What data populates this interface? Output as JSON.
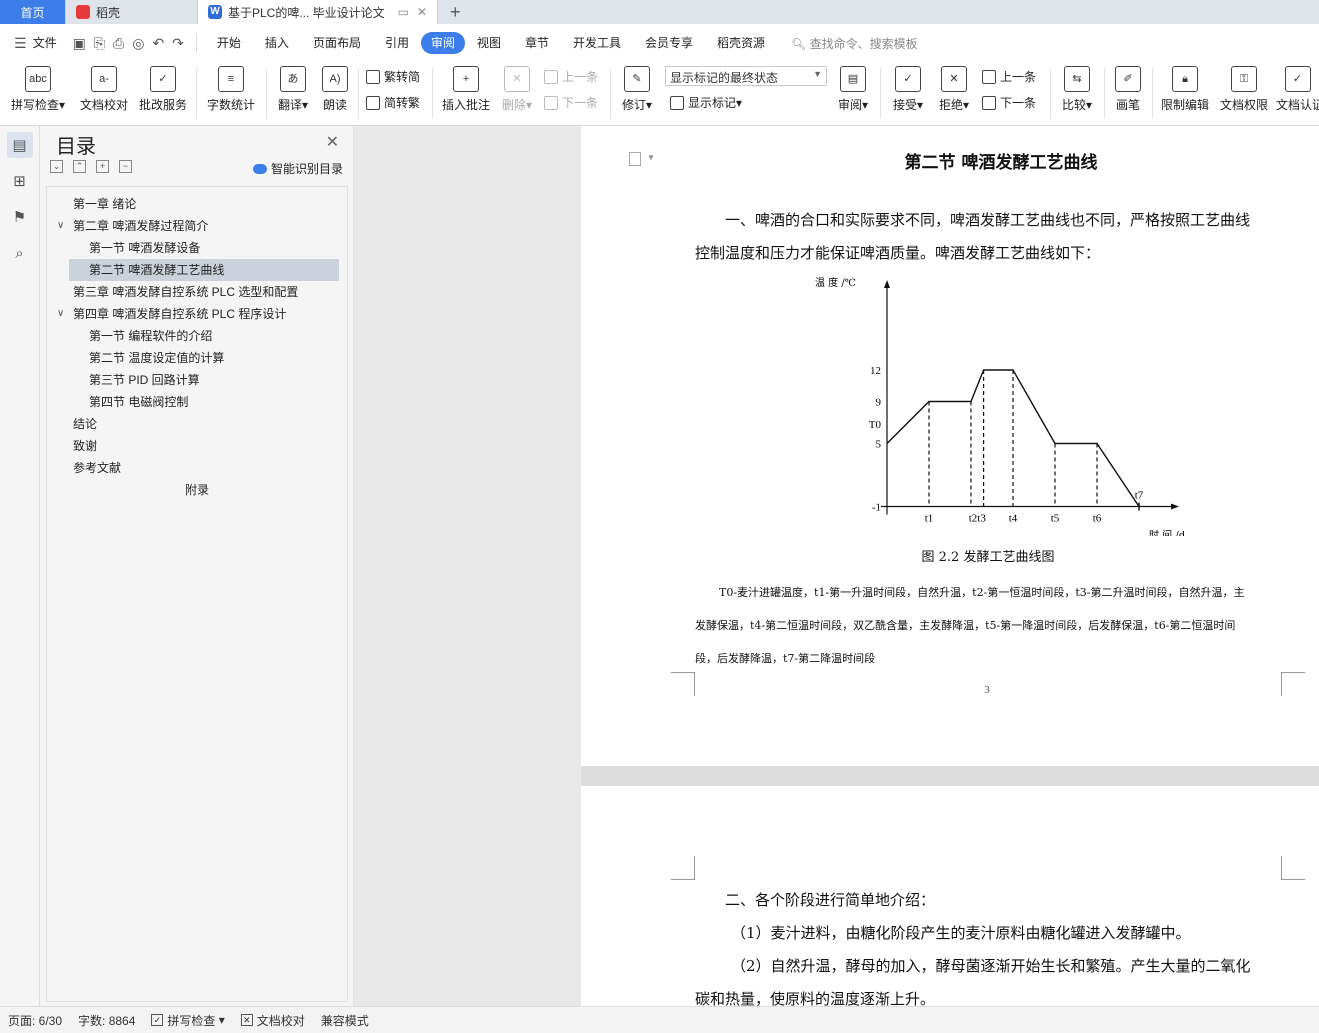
{
  "tabs": {
    "home": "首页",
    "daoke": "稻壳",
    "doc": "基于PLC的啤... 毕业设计论文",
    "new_tab": "+"
  },
  "menu": {
    "file": "文件",
    "items": [
      "开始",
      "插入",
      "页面布局",
      "引用",
      "审阅",
      "视图",
      "章节",
      "开发工具",
      "会员专享",
      "稻壳资源"
    ],
    "active": "审阅",
    "search_placeholder": "查找命令、搜索模板"
  },
  "ribbon": {
    "spell_check": "拼写检查",
    "doc_proof": "文档校对",
    "batch_service": "批改服务",
    "word_count": "字数统计",
    "translate": "翻译",
    "read_aloud": "朗读",
    "trad_to_simp": "繁转简",
    "simp_to_trad": "简转繁",
    "insert_comment": "插入批注",
    "delete": "删除",
    "prev_comment": "上一条",
    "next_comment": "下一条",
    "track": "修订",
    "markup_combo": "显示标记的最终状态",
    "show_markup": "显示标记",
    "review": "审阅",
    "accept": "接受",
    "reject": "拒绝",
    "prev_change": "上一条",
    "next_change": "下一条",
    "compare": "比较",
    "pen": "画笔",
    "restrict_edit": "限制编辑",
    "doc_rights": "文档权限",
    "doc_cert": "文档认证"
  },
  "toc": {
    "title": "目录",
    "smart": "智能识别目录",
    "items": [
      {
        "text": "第一章   绪论",
        "level": 1
      },
      {
        "text": "第二章   啤酒发酵过程简介",
        "level": 1,
        "expanded": true
      },
      {
        "text": "第一节  啤酒发酵设备",
        "level": 2
      },
      {
        "text": "第二节  啤酒发酵工艺曲线",
        "level": 2,
        "selected": true
      },
      {
        "text": "第三章   啤酒发酵自控系统 PLC 选型和配置",
        "level": 1
      },
      {
        "text": "第四章   啤酒发酵自控系统 PLC 程序设计",
        "level": 1,
        "expanded": true
      },
      {
        "text": "第一节  编程软件的介绍",
        "level": 2
      },
      {
        "text": "第二节  温度设定值的计算",
        "level": 2
      },
      {
        "text": "第三节  PID 回路计算",
        "level": 2
      },
      {
        "text": "第四节  电磁阀控制",
        "level": 2
      },
      {
        "text": "结论",
        "level": 1
      },
      {
        "text": "致谢",
        "level": 1
      },
      {
        "text": "参考文献",
        "level": 1
      },
      {
        "text": "附录",
        "level": 0
      }
    ]
  },
  "document": {
    "heading": "第二节  啤酒发酵工艺曲线",
    "para1_line1": "一、啤酒的合口和实际要求不同，啤酒发酵工艺曲线也不同，严格按照工艺曲线",
    "para1_line2": "控制温度和压力才能保证啤酒质量。啤酒发酵工艺曲线如下：",
    "caption": "图 2.2 发酵工艺曲线图",
    "legend_line1": "T0-麦汁进罐温度，t1-第一升温时间段，自然升温，t2-第一恒温时间段，t3-第二升温时间段，自然升温，主",
    "legend_line2": "发酵保温，t4-第二恒温时间段，双乙酰含量，主发酵降温，t5-第一降温时间段，后发酵保温，t6-第二恒温时间",
    "legend_line3": "段，后发酵降温，t7-第二降温时间段",
    "page_number": "3",
    "p2_line1": "二、各个阶段进行简单地介绍：",
    "p2_line2": "（1）麦汁进料，由糖化阶段产生的麦汁原料由糖化罐进入发酵罐中。",
    "p2_line3": "（2）自然升温，酵母的加入，酵母菌逐渐开始生长和繁殖。产生大量的二氧化",
    "p2_line4": "碳和热量，使原料的温度逐渐上升。"
  },
  "chart_data": {
    "type": "line",
    "ylabel": "温 度 /℃",
    "xlabel": "时 间 /d",
    "y_ticks": [
      "12",
      "9",
      "T0",
      "5",
      "-1"
    ],
    "x_ticks": [
      "t1",
      "t2t3",
      "t4",
      "t5",
      "t6",
      "t7"
    ],
    "points": [
      [
        0,
        5
      ],
      [
        1,
        9
      ],
      [
        2,
        9
      ],
      [
        2.3,
        12
      ],
      [
        3,
        12
      ],
      [
        4,
        5
      ],
      [
        5,
        5
      ],
      [
        6,
        -1
      ]
    ],
    "dashed_at": [
      "t1",
      "t2",
      "t3",
      "t4",
      "t5",
      "t6",
      "t7"
    ]
  },
  "status": {
    "page": "页面: 6/30",
    "words": "字数: 8864",
    "spell": "拼写检查",
    "proof": "文档校对",
    "compat": "兼容模式"
  }
}
